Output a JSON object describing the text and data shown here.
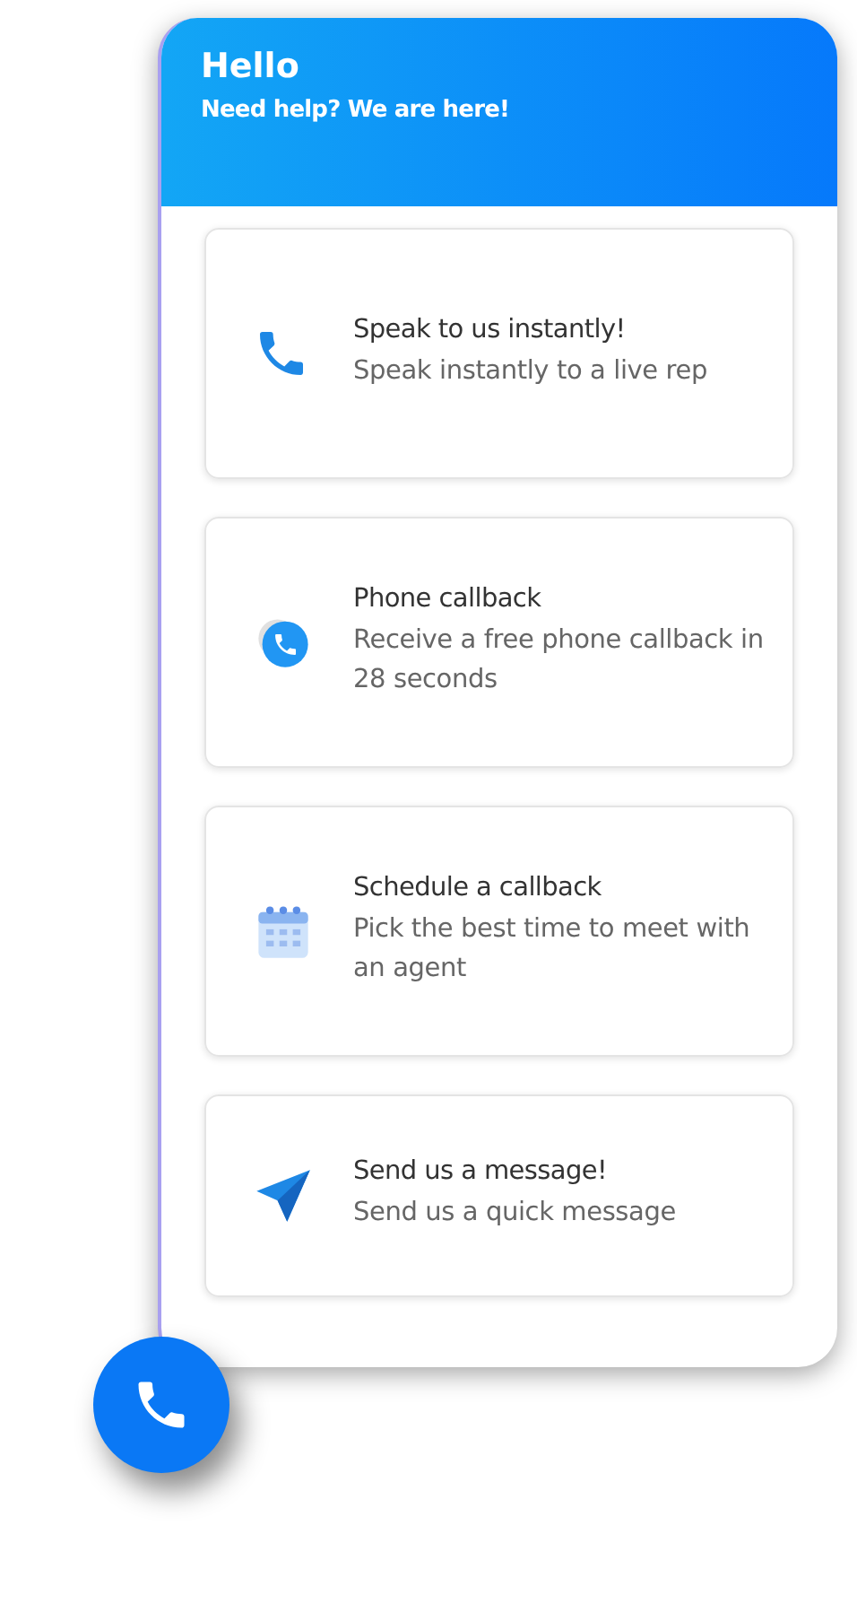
{
  "header": {
    "title": "Hello",
    "subtitle": "Need help? We are here!"
  },
  "options": [
    {
      "kind": "phone",
      "title": "Speak to us instantly!",
      "description": "Speak instantly to a live rep"
    },
    {
      "kind": "callback",
      "title": "Phone callback",
      "description": "Receive a free phone callback in 28 seconds"
    },
    {
      "kind": "calendar",
      "title": "Schedule a callback",
      "description": "Pick the best time to meet with an agent"
    },
    {
      "kind": "send",
      "title": "Send us a message!",
      "description": "Send us a quick message"
    }
  ]
}
